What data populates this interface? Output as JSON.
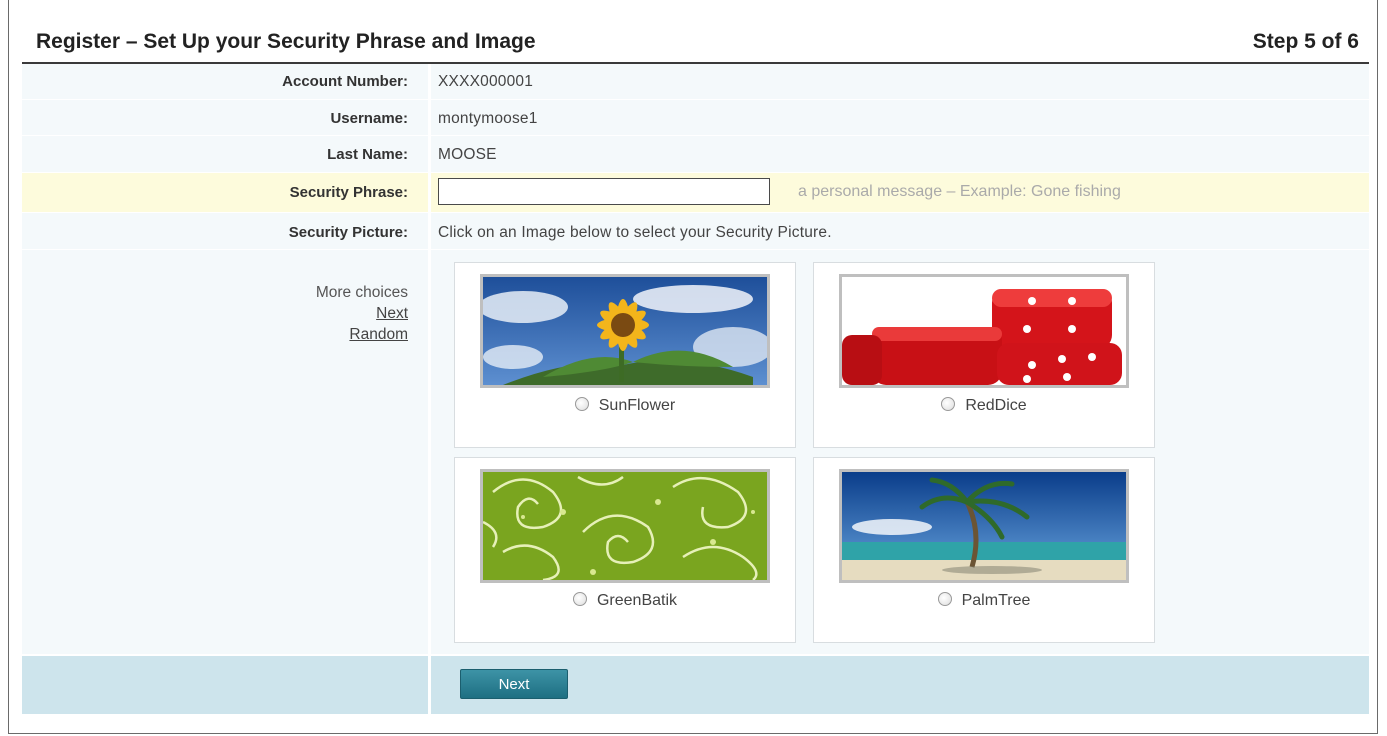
{
  "header": {
    "title": "Register – Set Up your Security Phrase and Image",
    "step": "Step 5 of 6"
  },
  "fields": {
    "account_number": {
      "label": "Account Number:",
      "value": "XXXX000001"
    },
    "username": {
      "label": "Username:",
      "value": "montymoose1"
    },
    "last_name": {
      "label": "Last Name:",
      "value": "MOOSE"
    },
    "security_phrase": {
      "label": "Security Phrase:",
      "value": "",
      "hint": "a personal message – Example: Gone fishing"
    },
    "security_picture": {
      "label": "Security Picture:",
      "instruction": "Click on an Image below to select your Security Picture."
    }
  },
  "more_choices": {
    "label": "More choices",
    "next": "Next",
    "random": "Random"
  },
  "pictures": [
    {
      "name": "SunFlower",
      "selected": false
    },
    {
      "name": "RedDice",
      "selected": false
    },
    {
      "name": "GreenBatik",
      "selected": false
    },
    {
      "name": "PalmTree",
      "selected": false
    }
  ],
  "footer": {
    "next_button": "Next"
  },
  "colors": {
    "accent": "#2a8196",
    "highlight_row": "#fdfbdc",
    "row_bg": "#f4f9fb",
    "footer_bg": "#cde4ec"
  }
}
